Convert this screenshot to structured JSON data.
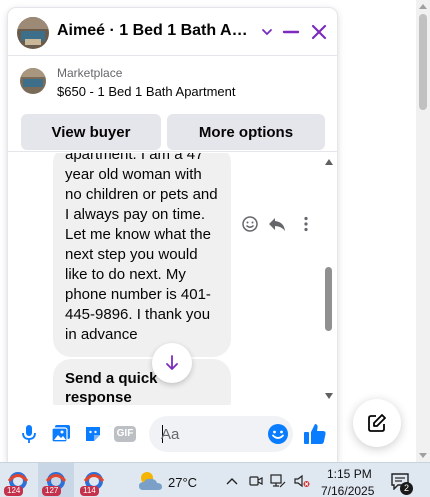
{
  "chat": {
    "title": "Aimeé · 1 Bed 1 Bath Apart...",
    "listing": {
      "source": "Marketplace",
      "title": "$650 - 1 Bed 1 Bath Apartment",
      "view_buyer_label": "View buyer",
      "more_options_label": "More options"
    },
    "message": {
      "lines": [
        "apartment. I am a 47",
        "year old woman with",
        "no children or pets and",
        "I always pay on time.",
        "Let me know what the",
        "next step you would",
        "like to do next. My",
        "phone number is 401-",
        "445-9896. I thank you",
        "in advance"
      ]
    },
    "quick_response": "Send a quick response",
    "composer": {
      "placeholder": "Aa",
      "gif_label": "GIF"
    }
  },
  "taskbar": {
    "apps": [
      {
        "icon": "browser-icon",
        "badge": "124"
      },
      {
        "icon": "browser-icon",
        "badge": "127"
      },
      {
        "icon": "browser-icon",
        "badge": "114"
      }
    ],
    "weather_icon": "partly-cloudy-icon",
    "temperature": "27°C",
    "time": "1:15 PM",
    "date": "7/16/2025",
    "notification_count": "2"
  },
  "colors": {
    "accent": "#7b2cbf",
    "messenger_blue": "#0a7cff",
    "bubble_bg": "#f0f0f0",
    "button_bg": "#e4e6eb"
  }
}
